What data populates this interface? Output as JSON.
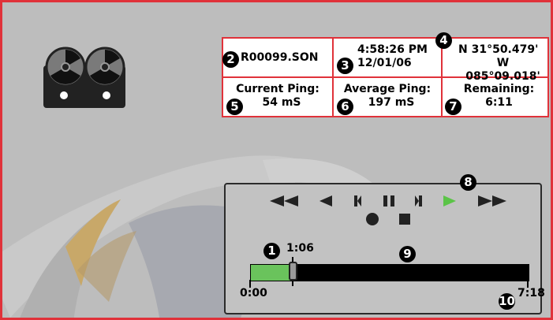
{
  "info": {
    "filename": "R00099.SON",
    "time": "4:58:26 PM",
    "date": "12/01/06",
    "lat": "N 31°50.479'",
    "lon": "W 085°09.018'",
    "current_ping_label": "Current Ping:",
    "current_ping_value": "54 mS",
    "average_ping_label": "Average Ping:",
    "average_ping_value": "197 mS",
    "remaining_label": "Remaining:",
    "remaining_value": "6:11"
  },
  "callouts": [
    "1",
    "2",
    "3",
    "4",
    "5",
    "6",
    "7",
    "8",
    "9",
    "10"
  ],
  "controls": [
    "fast-rewind",
    "rewind",
    "step-back",
    "pause",
    "step-forward",
    "play",
    "fast-forward",
    "record",
    "stop"
  ],
  "progress": {
    "start_label": "0:00",
    "current_label": "1:06",
    "end_label": "7:18",
    "fraction": 0.153
  },
  "colors": {
    "frame": "#e0323a",
    "play_active": "#5bc447",
    "progress_fill": "#6ac35c"
  }
}
